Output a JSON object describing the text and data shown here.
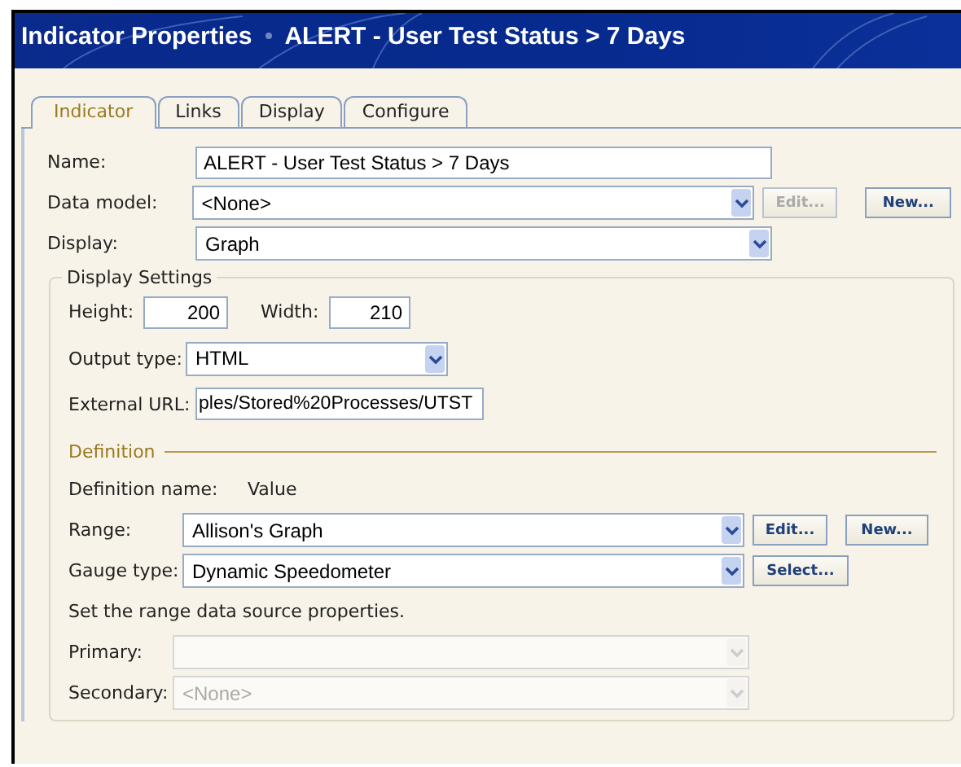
{
  "window": {
    "title": "Indicator Properties",
    "subtitle": "ALERT - User Test Status > 7 Days"
  },
  "tabs": [
    {
      "label": "Indicator",
      "selected": true
    },
    {
      "label": "Links",
      "selected": false
    },
    {
      "label": "Display",
      "selected": false
    },
    {
      "label": "Configure",
      "selected": false
    }
  ],
  "fields": [
    {
      "kind": "text",
      "label": "Name:",
      "value": "ALERT - User Test Status > 7 Days"
    },
    {
      "kind": "select",
      "label": "Data model:",
      "value": "<None>",
      "buttons": [
        {
          "label": "Edit...",
          "disabled": true
        },
        {
          "label": "New...",
          "disabled": false
        }
      ]
    },
    {
      "kind": "select",
      "label": "Display:",
      "value": "Graph"
    }
  ],
  "display_settings": {
    "legend": "Display Settings",
    "height": {
      "label": "Height:",
      "value": "200"
    },
    "width": {
      "label": "Width:",
      "value": "210"
    },
    "output_type": {
      "label": "Output type:",
      "value": "HTML"
    },
    "external_url": {
      "label": "External URL:",
      "value": "ples/Stored%20Processes/UTST"
    }
  },
  "definition": {
    "legend": "Definition",
    "name_label": "Definition name:",
    "name_value": "Value",
    "range": {
      "label": "Range:",
      "value": "Allison's Graph",
      "disabled": false,
      "buttons": [
        {
          "label": "Edit...",
          "disabled": false
        },
        {
          "label": "New...",
          "disabled": false
        }
      ]
    },
    "gauge_type": {
      "label": "Gauge type:",
      "value": "Dynamic Speedometer",
      "disabled": false,
      "buttons": [
        {
          "label": "Select...",
          "disabled": false
        }
      ]
    },
    "note": "Set the range data source properties.",
    "primary": {
      "label": "Primary:",
      "disabled": true
    },
    "secondary": {
      "label": "Secondary:",
      "value": "<None>",
      "disabled": true
    }
  }
}
